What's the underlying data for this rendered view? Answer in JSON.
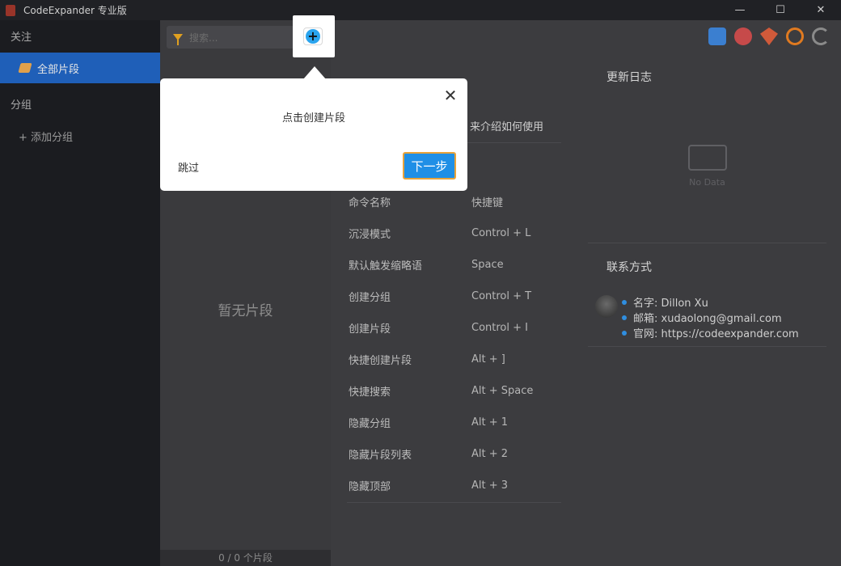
{
  "window": {
    "title": "CodeExpander 专业版",
    "controls": {
      "minimize": "—",
      "maximize": "☐",
      "close": "✕"
    }
  },
  "sidebar": {
    "follow_label": "关注",
    "all_snippets_label": "全部片段",
    "group_label": "分组",
    "add_group_label": "+ 添加分组"
  },
  "list": {
    "search_placeholder": "搜索...",
    "empty_text": "暂无片段",
    "footer_count": "0 / 0 个片段"
  },
  "main": {
    "intro_text": "来介绍如何使用",
    "shortcuts_header": {
      "name": "命令名称",
      "key": "快捷键"
    },
    "shortcuts": [
      {
        "name": "沉浸模式",
        "key": "Control + L"
      },
      {
        "name": "默认触发缩略语",
        "key": "Space"
      },
      {
        "name": "创建分组",
        "key": "Control + T"
      },
      {
        "name": "创建片段",
        "key": "Control + I"
      },
      {
        "name": "快捷创建片段",
        "key": "Alt + ]"
      },
      {
        "name": "快捷搜索",
        "key": "Alt + Space"
      },
      {
        "name": "隐藏分组",
        "key": "Alt + 1"
      },
      {
        "name": "隐藏片段列表",
        "key": "Alt + 2"
      },
      {
        "name": "隐藏顶部",
        "key": "Alt + 3"
      }
    ],
    "changelog_title": "更新日志",
    "no_data": "No Data",
    "contact_title": "联系方式",
    "contacts": [
      "名字: Dillon Xu",
      "邮箱: xudaolong@gmail.com",
      "官网: https://codeexpander.com"
    ]
  },
  "tour": {
    "message": "点击创建片段",
    "skip_label": "跳过",
    "next_label": "下一步",
    "close_glyph": "✕",
    "plus_glyph": "+"
  },
  "colors": {
    "accent_blue": "#1f8fe6",
    "sidebar_active": "#1f5fb8",
    "next_border": "#e8a33a"
  }
}
